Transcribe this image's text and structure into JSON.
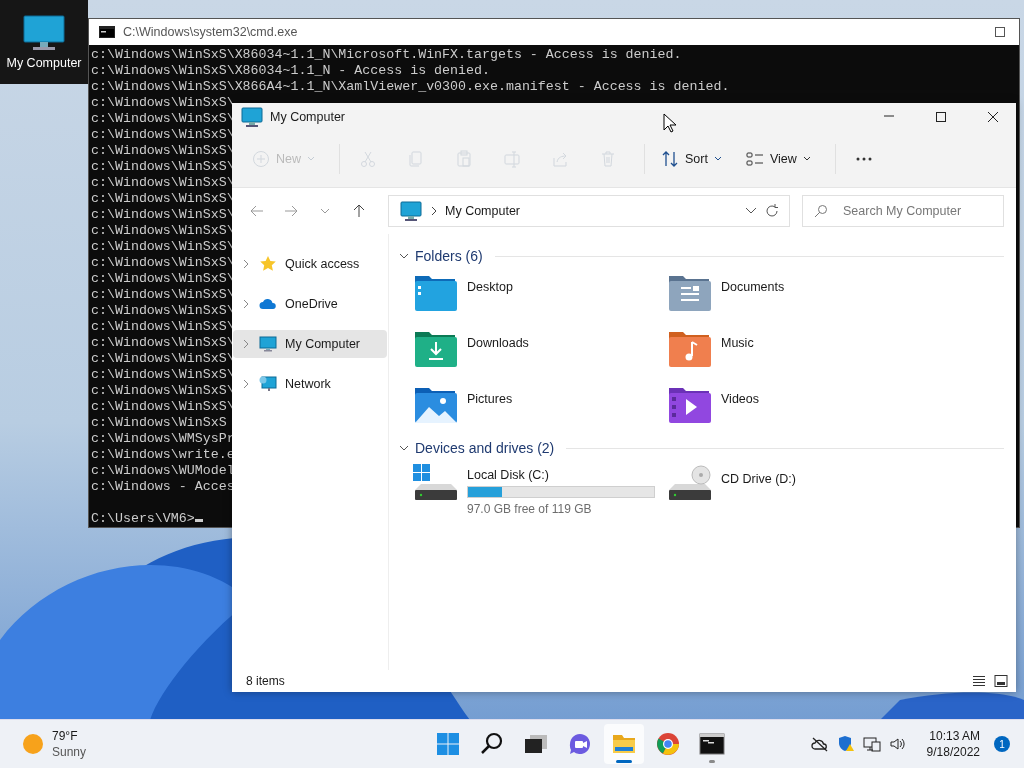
{
  "desktop": {
    "icons": [
      {
        "label": "My Computer",
        "selected": true
      }
    ]
  },
  "console": {
    "title": "C:\\Windows\\system32\\cmd.exe",
    "lines": [
      "c:\\Windows\\WinSxS\\X86034~1.1_N\\Microsoft.WinFX.targets - Access is denied.",
      "c:\\Windows\\WinSxS\\X86034~1.1_N - Access is denied.",
      "c:\\Windows\\WinSxS\\X866A4~1.1_N\\XamlViewer_v0300.exe.manifest - Access is denied.",
      "c:\\Windows\\WinSxS\\",
      "c:\\Windows\\WinSxS\\",
      "c:\\Windows\\WinSxS\\",
      "c:\\Windows\\WinSxS\\",
      "c:\\Windows\\WinSxS\\",
      "c:\\Windows\\WinSxS\\",
      "c:\\Windows\\WinSxS\\",
      "c:\\Windows\\WinSxS\\",
      "c:\\Windows\\WinSxS\\",
      "c:\\Windows\\WinSxS\\",
      "c:\\Windows\\WinSxS\\",
      "c:\\Windows\\WinSxS\\",
      "c:\\Windows\\WinSxS\\",
      "c:\\Windows\\WinSxS\\",
      "c:\\Windows\\WinSxS\\",
      "c:\\Windows\\WinSxS\\",
      "c:\\Windows\\WinSxS\\",
      "c:\\Windows\\WinSxS\\",
      "c:\\Windows\\WinSxS\\",
      "c:\\Windows\\WinSxS\\",
      "c:\\Windows\\WinSxS",
      "c:\\Windows\\WMSysPr",
      "c:\\Windows\\write.e",
      "c:\\Windows\\WUModel",
      "c:\\Windows - Acces"
    ],
    "prompt": "C:\\Users\\VM6>"
  },
  "explorer": {
    "title": "My Computer",
    "toolbar": [
      {
        "kind": "new",
        "label": "New",
        "disabled": true
      },
      {
        "kind": "cut",
        "disabled": true
      },
      {
        "kind": "copy",
        "disabled": true
      },
      {
        "kind": "paste",
        "disabled": true
      },
      {
        "kind": "rename",
        "disabled": true
      },
      {
        "kind": "share",
        "disabled": true
      },
      {
        "kind": "delete",
        "disabled": true
      },
      {
        "kind": "sort",
        "label": "Sort",
        "disabled": false
      },
      {
        "kind": "view",
        "label": "View",
        "disabled": false
      },
      {
        "kind": "more",
        "disabled": false
      }
    ],
    "address": "My Computer",
    "search": {
      "placeholder": "Search My Computer"
    },
    "nav": [
      {
        "label": "Quick access",
        "kind": "star",
        "expanded": false,
        "selected": false
      },
      {
        "label": "OneDrive",
        "kind": "cloud",
        "expanded": false,
        "selected": false
      },
      {
        "label": "My Computer",
        "kind": "computer",
        "expanded": false,
        "selected": true
      },
      {
        "label": "Network",
        "kind": "network",
        "expanded": false,
        "selected": false
      }
    ],
    "sections": [
      {
        "title": "Folders (6)",
        "expanded": true,
        "items": [
          {
            "label": "Desktop",
            "kind": "desktop"
          },
          {
            "label": "Documents",
            "kind": "documents"
          },
          {
            "label": "Downloads",
            "kind": "downloads"
          },
          {
            "label": "Music",
            "kind": "music"
          },
          {
            "label": "Pictures",
            "kind": "pictures"
          },
          {
            "label": "Videos",
            "kind": "videos"
          }
        ]
      },
      {
        "title": "Devices and drives (2)",
        "expanded": true,
        "items": [
          {
            "label": "Local Disk (C:)",
            "kind": "disk",
            "level": 0.185,
            "detail": "97.0 GB free of 119 GB"
          },
          {
            "label": "CD Drive (D:)",
            "kind": "cd"
          }
        ]
      }
    ],
    "status": "8 items"
  },
  "taskbar": {
    "weather": {
      "temp": "79°F",
      "condition": "Sunny"
    },
    "apps": [
      {
        "kind": "start",
        "active": false,
        "running": false
      },
      {
        "kind": "search",
        "active": false,
        "running": false
      },
      {
        "kind": "taskview",
        "active": false,
        "running": false
      },
      {
        "kind": "chat",
        "active": false,
        "running": false
      },
      {
        "kind": "explorer",
        "active": true,
        "running": true
      },
      {
        "kind": "browser",
        "active": false,
        "running": false
      },
      {
        "kind": "terminal",
        "active": false,
        "running": true
      }
    ],
    "time": "10:13 AM",
    "date": "9/18/2022",
    "badge": "1"
  }
}
